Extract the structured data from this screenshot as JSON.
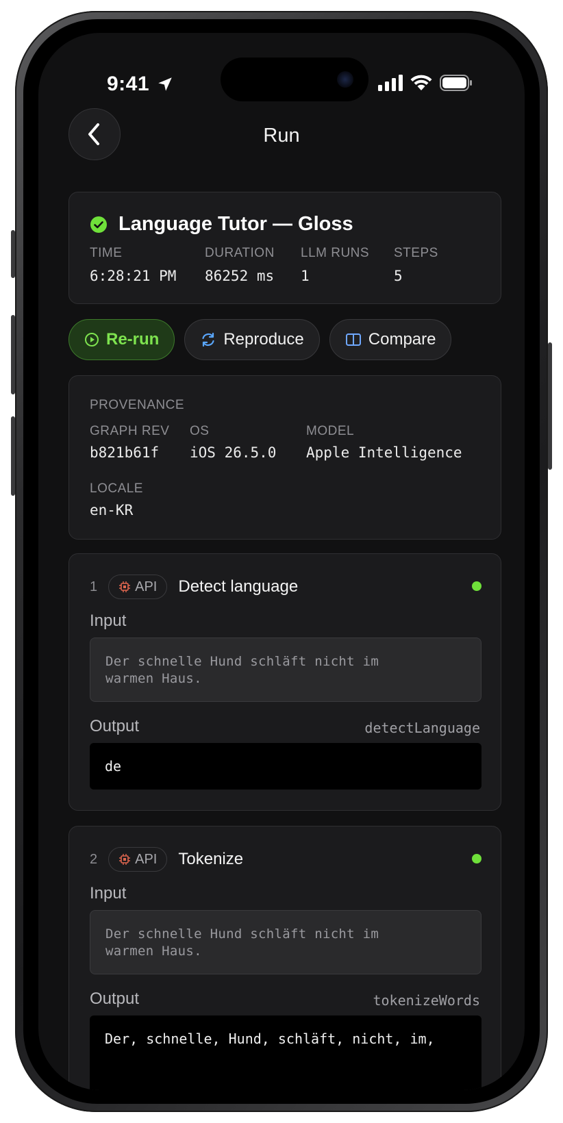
{
  "status_bar": {
    "time": "9:41"
  },
  "nav": {
    "title": "Run"
  },
  "summary": {
    "title": "Language Tutor — Gloss",
    "meta": [
      {
        "label": "TIME",
        "value": "6:28:21 PM"
      },
      {
        "label": "DURATION",
        "value": "86252 ms"
      },
      {
        "label": "LLM RUNS",
        "value": "1"
      },
      {
        "label": "STEPS",
        "value": "5"
      }
    ]
  },
  "actions": {
    "rerun": "Re-run",
    "reproduce": "Reproduce",
    "compare": "Compare"
  },
  "provenance": {
    "heading": "PROVENANCE",
    "fields": [
      {
        "label": "GRAPH REV",
        "value": "b821b61f"
      },
      {
        "label": "OS",
        "value": "iOS 26.5.0"
      },
      {
        "label": "MODEL",
        "value": "Apple Intelligence"
      },
      {
        "label": "LOCALE",
        "value": "en-KR"
      }
    ]
  },
  "steps": [
    {
      "number": "1",
      "badge": "API",
      "name": "Detect language",
      "input_label": "Input",
      "input_lines": [
        "Der schnelle Hund schläft nicht im",
        "warmen Haus."
      ],
      "output_label": "Output",
      "function": "detectLanguage",
      "output": "de"
    },
    {
      "number": "2",
      "badge": "API",
      "name": "Tokenize",
      "input_label": "Input",
      "input_lines": [
        "Der schnelle Hund schläft nicht im",
        "warmen Haus."
      ],
      "output_label": "Output",
      "function": "tokenizeWords",
      "output": "Der, schnelle, Hund, schläft, nicht, im,"
    }
  ],
  "colors": {
    "accent_green": "#6fe03a",
    "badge_icon": "#e0664f",
    "reproduce_icon": "#5aa7ff",
    "compare_icon": "#6fa8ff"
  }
}
